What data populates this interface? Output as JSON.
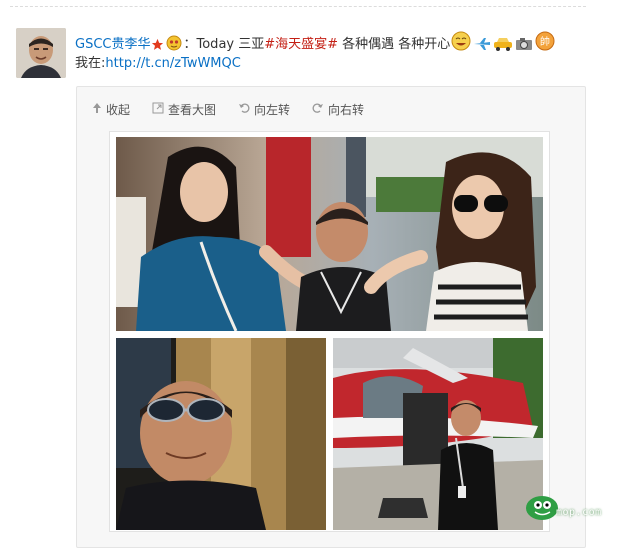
{
  "post": {
    "author": "GSCC贵李华",
    "separator": "：",
    "text_before": "Today 三亚",
    "hashtag": "#海天盛宴#",
    "text_after": " 各种偶遇 各种开心",
    "location_label": "我在:",
    "link": "http://t.cn/zTwWMQC"
  },
  "toolbar": {
    "collapse": "收起",
    "view_large": "查看大图",
    "rotate_left": "向左转",
    "rotate_right": "向右转"
  },
  "watermark": {
    "text": "mop.com"
  },
  "icons": {
    "verified": "star-badge-icon",
    "emoji1": "face-emoji-icon",
    "emoji2": "laughing-emoji-icon",
    "plane": "airplane-icon",
    "car": "car-icon",
    "camera": "camera-icon",
    "handsome": "handsome-badge-icon"
  },
  "colors": {
    "link": "#0a70c5",
    "hashtag": "#c41f14",
    "panel": "#f7f7f7"
  }
}
